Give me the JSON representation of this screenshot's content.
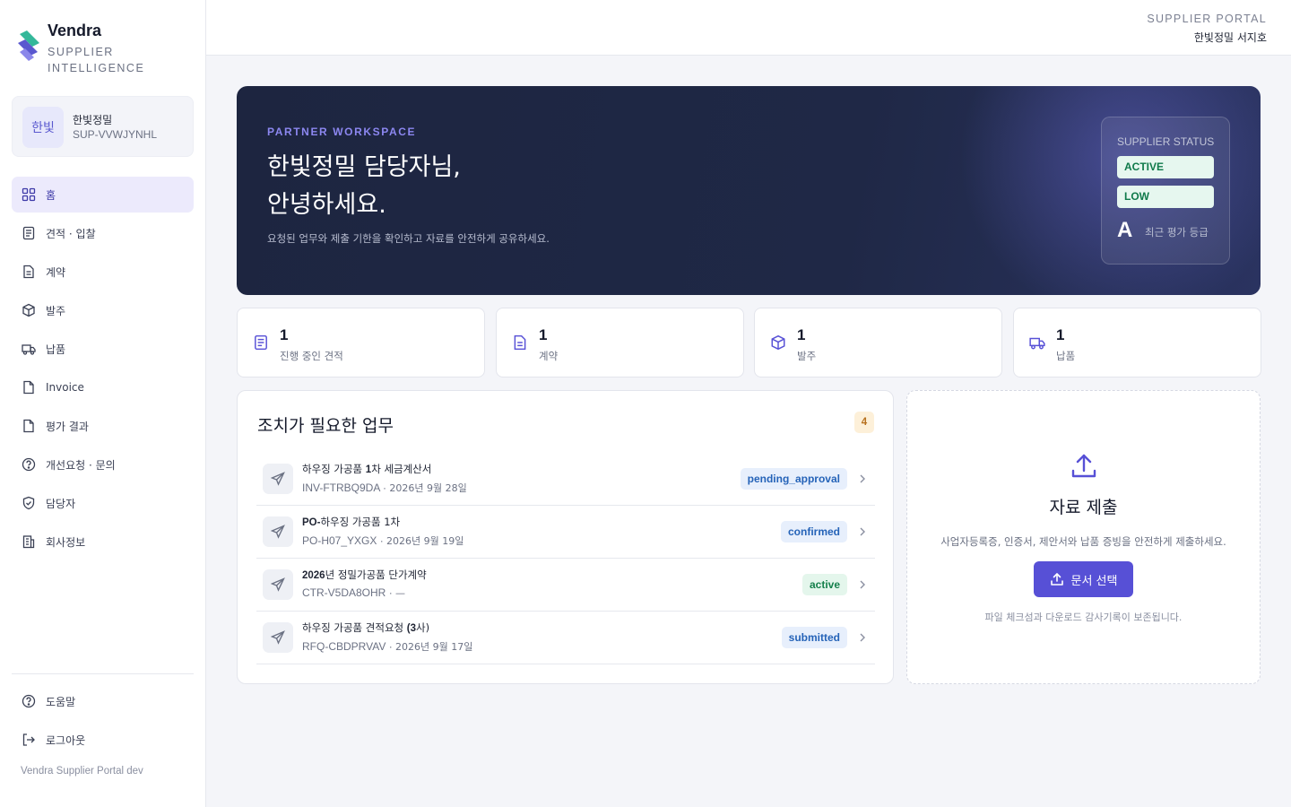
{
  "brand": {
    "name": "Vendra",
    "subtitle": "SUPPLIER INTELLIGENCE"
  },
  "org": {
    "avatar": "한빛",
    "name": "한빛정밀",
    "code": "SUP-VVWJYNHL"
  },
  "nav": {
    "items": [
      {
        "label": "홈",
        "icon": "grid-icon",
        "active": true
      },
      {
        "label": "견적 · 입찰",
        "icon": "clipboard-icon"
      },
      {
        "label": "계약",
        "icon": "document-icon"
      },
      {
        "label": "발주",
        "icon": "package-icon"
      },
      {
        "label": "납품",
        "icon": "truck-icon"
      },
      {
        "label": "Invoice",
        "icon": "file-icon"
      },
      {
        "label": "평가 결과",
        "icon": "file-icon"
      },
      {
        "label": "개선요청 · 문의",
        "icon": "help-circle-icon"
      },
      {
        "label": "담당자",
        "icon": "shield-icon"
      },
      {
        "label": "회사정보",
        "icon": "building-icon"
      }
    ],
    "bottom": [
      {
        "label": "도움말",
        "icon": "help-circle-icon"
      },
      {
        "label": "로그아웃",
        "icon": "logout-icon"
      }
    ],
    "version": "Vendra Supplier Portal dev"
  },
  "header": {
    "portal_label": "SUPPLIER PORTAL",
    "user": "한빛정밀 서지호"
  },
  "hero": {
    "kicker": "PARTNER WORKSPACE",
    "title_line1": "한빛정밀 담당자님,",
    "title_line2": "안녕하세요.",
    "description": "요청된 업무와 제출 기한을 확인하고 자료를 안전하게 공유하세요.",
    "status": {
      "title": "SUPPLIER STATUS",
      "state": "ACTIVE",
      "risk": "LOW",
      "grade": "A",
      "grade_label": "최근 평가 등급"
    }
  },
  "stats": [
    {
      "value": "1",
      "label": "진행 중인 견적",
      "icon": "clipboard-icon"
    },
    {
      "value": "1",
      "label": "계약",
      "icon": "document-icon"
    },
    {
      "value": "1",
      "label": "발주",
      "icon": "package-icon"
    },
    {
      "value": "1",
      "label": "납품",
      "icon": "truck-icon"
    }
  ],
  "tasks": {
    "title": "조치가 필요한 업무",
    "count": "4",
    "items": [
      {
        "title_pre": "하우징 가공품 ",
        "title_bold": "1",
        "title_post": "차 세금계산서",
        "code": "INV-FTRBQ9DA",
        "date": "2026년 9월 28일",
        "status": "pending_approval",
        "tone": "blue"
      },
      {
        "title_pre": "",
        "title_bold": "PO-",
        "title_post": "하우징 가공품 1차",
        "code": "PO-H07_YXGX",
        "date": "2026년 9월 19일",
        "status": "confirmed",
        "tone": "blue"
      },
      {
        "title_pre": "",
        "title_bold": "2026",
        "title_post": "년 정밀가공품 단가계약",
        "code": "CTR-V5DA8OHR",
        "date": "—",
        "status": "active",
        "tone": "green"
      },
      {
        "title_pre": "하우징 가공품 견적요청 ",
        "title_bold": "(3",
        "title_post": "사)",
        "code": "RFQ-CBDPRVAV",
        "date": "2026년 9월 17일",
        "status": "submitted",
        "tone": "blue"
      }
    ]
  },
  "upload": {
    "title": "자료 제출",
    "description": "사업자등록증, 인증서, 제안서와 납품 증빙을 안전하게 제출하세요.",
    "button": "문서 선택",
    "note": "파일 체크섬과 다운로드 감사기록이 보존됩니다."
  },
  "colors": {
    "accent": "#5750d6",
    "hero_bg": "#1d2540",
    "badge_green": "#15804c",
    "badge_blue": "#2563b8"
  }
}
